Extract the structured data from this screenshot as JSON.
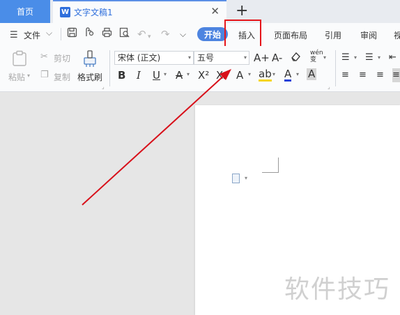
{
  "tabs": {
    "home_label": "首页",
    "doc_icon": "W",
    "doc_label": "文字文稿1",
    "close_glyph": "✕",
    "new_tab_glyph": "+"
  },
  "menu": {
    "file_label": "文件",
    "start_label": "开始",
    "insert_label": "插入",
    "layout_label": "页面布局",
    "references_label": "引用",
    "review_label": "审阅",
    "view_label_partial": "视"
  },
  "ribbon": {
    "paste_label": "粘贴",
    "cut_label": "剪切",
    "copy_label": "复制",
    "format_painter_label": "格式刷",
    "font_name": "宋体 (正文)",
    "font_size": "五号",
    "grow_font": "A+",
    "shrink_font": "A-",
    "pinyin_label": "wén",
    "bold": "B",
    "italic": "I",
    "underline": "U",
    "strikethrough": "A",
    "superscript": "X²",
    "subscript": "X₂",
    "text_effect": "A",
    "highlight": "ab",
    "font_color": "A",
    "char_shading": "A"
  },
  "document": {
    "watermark": "软件技巧"
  },
  "colors": {
    "accent": "#4a8de8",
    "highlight_box": "#e5151a",
    "arrow": "#d8101a"
  }
}
